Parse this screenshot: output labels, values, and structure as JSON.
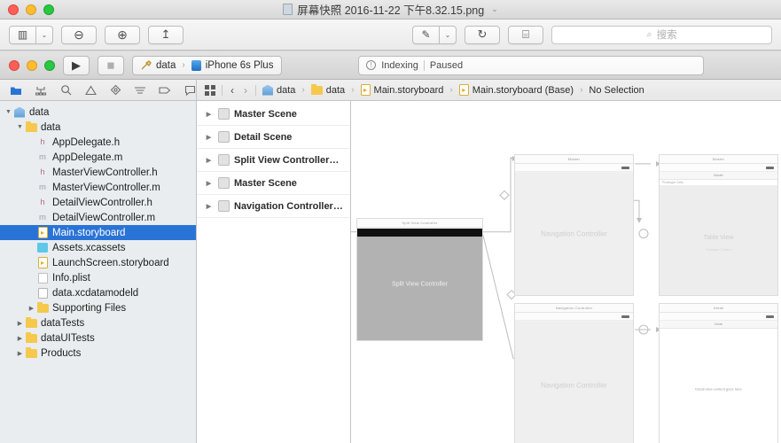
{
  "preview": {
    "title": "屏幕快照 2016-11-22 下午8.32.15.png",
    "title_chevron": "⌄",
    "toolbar": {
      "sidebar_label": "▥",
      "sidebar_chevron": "⌄",
      "zoom_out_label": "⊖",
      "zoom_in_label": "⊕",
      "share_label": "↥",
      "markup_label": "✎",
      "markup_chevron": "⌄",
      "rotate_label": "↻",
      "toolkit_label": "⌸"
    },
    "search": {
      "placeholder": "搜索",
      "icon": "search-icon",
      "glyph": "⌕"
    }
  },
  "xcode": {
    "toolbar": {
      "run_label": "▶",
      "stop_label": "◼",
      "scheme_project": "data",
      "scheme_separator": "›",
      "scheme_device": "iPhone 6s Plus",
      "status_icon_glyph": "!",
      "status_primary": "Indexing",
      "status_secondary": "Paused"
    },
    "navstrip": {
      "grid_glyph": "▦",
      "back_glyph": "‹",
      "forward_glyph": "›",
      "navigator_tabs": [
        {
          "name": "project-navigator",
          "glyph": "🗀",
          "active": true
        },
        {
          "name": "source-control-navigator",
          "glyph": "⑂",
          "active": false
        },
        {
          "name": "symbol-navigator",
          "glyph": "⌕",
          "active": false
        },
        {
          "name": "issue-navigator",
          "glyph": "⚠",
          "active": false
        },
        {
          "name": "test-navigator",
          "glyph": "◈",
          "active": false
        },
        {
          "name": "debug-navigator",
          "glyph": "≡",
          "active": false
        },
        {
          "name": "breakpoint-navigator",
          "glyph": "▷",
          "active": false
        },
        {
          "name": "report-navigator",
          "glyph": "🗩",
          "active": false
        }
      ],
      "breadcrumb": [
        {
          "label": "data",
          "icon": "project-icon"
        },
        {
          "label": "data",
          "icon": "folder-icon"
        },
        {
          "label": "Main.storyboard",
          "icon": "storyboard-icon"
        },
        {
          "label": "Main.storyboard (Base)",
          "icon": "storyboard-icon"
        },
        {
          "label": "No Selection",
          "icon": "none"
        }
      ]
    },
    "navigator": {
      "files": [
        {
          "label": "data",
          "indent": 0,
          "disclosure": "▼",
          "icon": "project-icon",
          "selected": false
        },
        {
          "label": "data",
          "indent": 1,
          "disclosure": "▼",
          "icon": "folder-icon",
          "selected": false
        },
        {
          "label": "AppDelegate.h",
          "indent": 2,
          "disclosure": "",
          "icon": "header-icon",
          "selected": false
        },
        {
          "label": "AppDelegate.m",
          "indent": 2,
          "disclosure": "",
          "icon": "method-icon",
          "selected": false
        },
        {
          "label": "MasterViewController.h",
          "indent": 2,
          "disclosure": "",
          "icon": "header-icon",
          "selected": false
        },
        {
          "label": "MasterViewController.m",
          "indent": 2,
          "disclosure": "",
          "icon": "method-icon",
          "selected": false
        },
        {
          "label": "DetailViewController.h",
          "indent": 2,
          "disclosure": "",
          "icon": "header-icon",
          "selected": false
        },
        {
          "label": "DetailViewController.m",
          "indent": 2,
          "disclosure": "",
          "icon": "method-icon",
          "selected": false
        },
        {
          "label": "Main.storyboard",
          "indent": 2,
          "disclosure": "",
          "icon": "storyboard-icon",
          "selected": true
        },
        {
          "label": "Assets.xcassets",
          "indent": 2,
          "disclosure": "",
          "icon": "xcassets-icon",
          "selected": false
        },
        {
          "label": "LaunchScreen.storyboard",
          "indent": 2,
          "disclosure": "",
          "icon": "storyboard-icon",
          "selected": false
        },
        {
          "label": "Info.plist",
          "indent": 2,
          "disclosure": "",
          "icon": "plist-icon",
          "selected": false
        },
        {
          "label": "data.xcdatamodeld",
          "indent": 2,
          "disclosure": "",
          "icon": "xcdatamodel-icon",
          "selected": false
        },
        {
          "label": "Supporting Files",
          "indent": 2,
          "disclosure": "▶",
          "icon": "folder-icon",
          "selected": false
        },
        {
          "label": "dataTests",
          "indent": 1,
          "disclosure": "▶",
          "icon": "folder-icon",
          "selected": false
        },
        {
          "label": "dataUITests",
          "indent": 1,
          "disclosure": "▶",
          "icon": "folder-icon",
          "selected": false
        },
        {
          "label": "Products",
          "indent": 1,
          "disclosure": "▶",
          "icon": "folder-icon",
          "selected": false
        }
      ]
    },
    "outline": {
      "scenes": [
        {
          "label": "Master Scene",
          "disclosure": "▶",
          "icon": "view-controller-icon"
        },
        {
          "label": "Detail Scene",
          "disclosure": "▶",
          "icon": "table-view-icon"
        },
        {
          "label": "Split View Controller…",
          "disclosure": "▶",
          "icon": "split-view-icon"
        },
        {
          "label": "Master Scene",
          "disclosure": "▶",
          "icon": "navigation-controller-icon"
        },
        {
          "label": "Navigation Controller…",
          "disclosure": "▶",
          "icon": "navigation-controller-icon"
        }
      ]
    },
    "canvas": {
      "scenes": [
        {
          "name": "split-view-controller-scene",
          "title": "Split View Controller",
          "label": "Split View Controller"
        },
        {
          "name": "navigation-controller-scene-top",
          "title": "Master",
          "label": "Navigation Controller"
        },
        {
          "name": "navigation-controller-scene-bottom",
          "title": "Navigation Controller",
          "label": "Navigation Controller"
        },
        {
          "name": "master-scene",
          "title": "Master",
          "subtitle": "Master",
          "cell_header": "Prototype Cells",
          "cell_title": "Title",
          "table_label": "Table View",
          "table_sublabel": "Prototype Content"
        },
        {
          "name": "detail-scene",
          "title": "Detail",
          "subtitle": "Detail",
          "label": "Detail view content goes here"
        }
      ]
    }
  }
}
